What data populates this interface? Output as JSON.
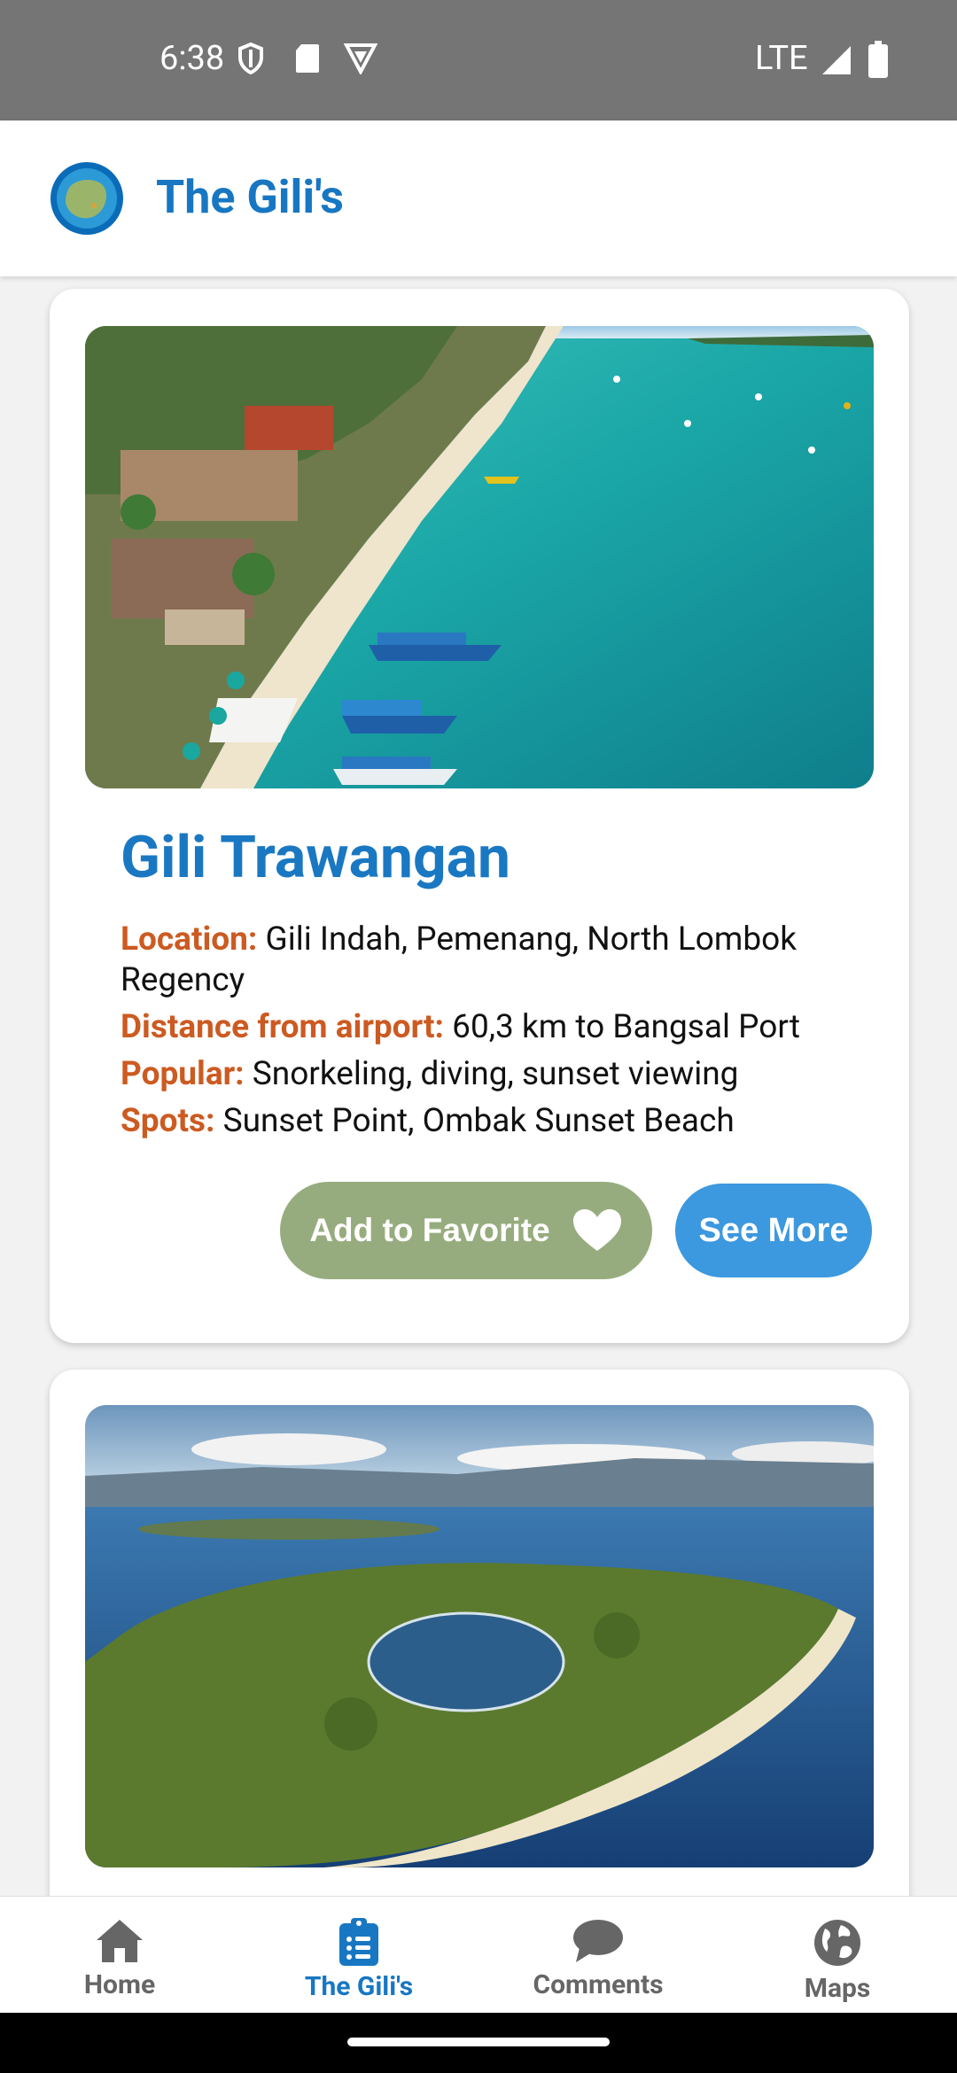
{
  "status": {
    "time": "6:38",
    "network": "LTE"
  },
  "app": {
    "title": "The Gili's",
    "accent_color": "#1877c2"
  },
  "cards": [
    {
      "title": "Gili Trawangan",
      "image": "beach-aerial-photo",
      "details": [
        {
          "label": "Location:",
          "value": "Gili Indah, Pemenang, North Lombok Regency"
        },
        {
          "label": "Distance from airport:",
          "value": "60,3 km to Bangsal Port"
        },
        {
          "label": "Popular:",
          "value": "Snorkeling, diving, sunset viewing"
        },
        {
          "label": "Spots:",
          "value": "Sunset Point, Ombak Sunset Beach"
        }
      ],
      "favorite_button": "Add to Favorite",
      "favorite_icon": "heart-icon",
      "more_button": "See More"
    },
    {
      "image": "island-lake-aerial-photo"
    }
  ],
  "nav": {
    "items": [
      {
        "label": "Home",
        "icon": "home-icon"
      },
      {
        "label": "The Gili's",
        "icon": "clipboard-list-icon"
      },
      {
        "label": "Comments",
        "icon": "comment-icon"
      },
      {
        "label": "Maps",
        "icon": "globe-icon"
      }
    ],
    "active_index": 1
  }
}
